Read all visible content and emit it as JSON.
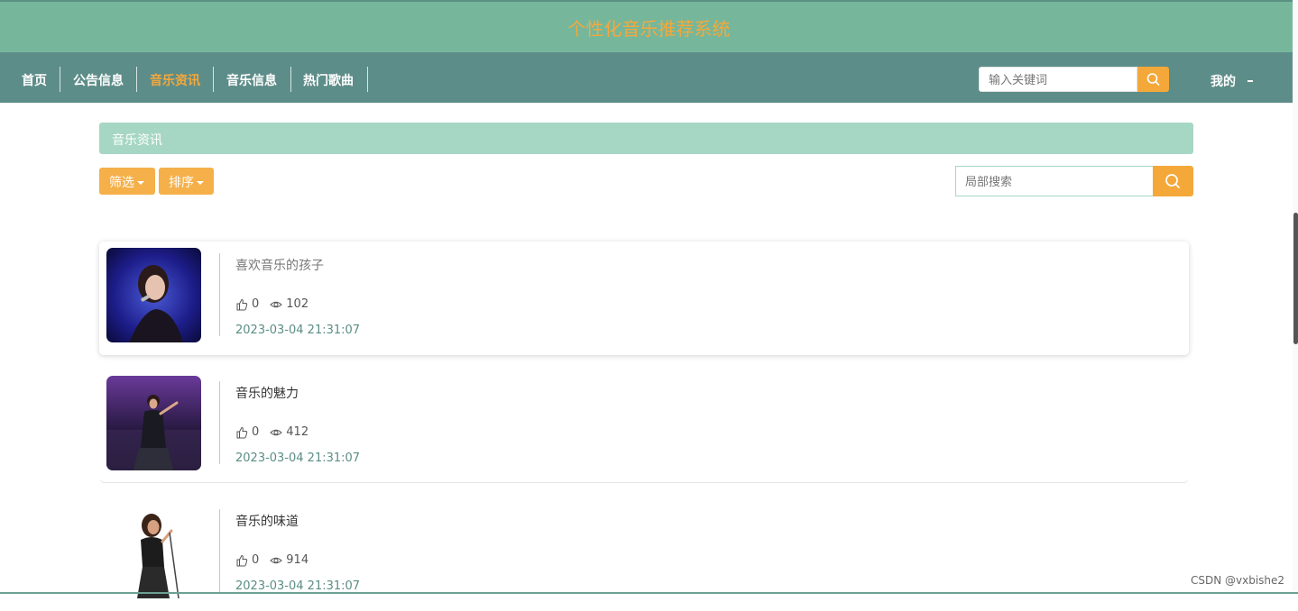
{
  "header": {
    "site_title": "个性化音乐推荐系统"
  },
  "nav": {
    "items": [
      {
        "label": "首页"
      },
      {
        "label": "公告信息"
      },
      {
        "label": "音乐资讯"
      },
      {
        "label": "音乐信息"
      },
      {
        "label": "热门歌曲"
      }
    ],
    "active": "音乐资讯",
    "search_placeholder": "输入关键词",
    "my_label": "我的"
  },
  "section": {
    "title": "音乐资讯",
    "filter_label": "筛选",
    "sort_label": "排序",
    "search_placeholder": "局部搜索"
  },
  "news": [
    {
      "title": "喜欢音乐的孩子",
      "likes": "0",
      "views": "102",
      "date": "2023-03-04 21:31:07"
    },
    {
      "title": "音乐的魅力",
      "likes": "0",
      "views": "412",
      "date": "2023-03-04 21:31:07"
    },
    {
      "title": "音乐的味道",
      "likes": "0",
      "views": "914",
      "date": "2023-03-04 21:31:07"
    }
  ],
  "watermark": "CSDN @vxbishe2",
  "colors": {
    "header_bg": "#76b79c",
    "nav_bg": "#5d8d89",
    "accent": "#f5a83a",
    "section_bar": "#a6d7c5",
    "date_text": "#5a8e84"
  },
  "icons": {
    "search": "search-icon",
    "like": "thumbs-up-icon",
    "views": "eye-icon",
    "caret": "caret-down-icon"
  }
}
